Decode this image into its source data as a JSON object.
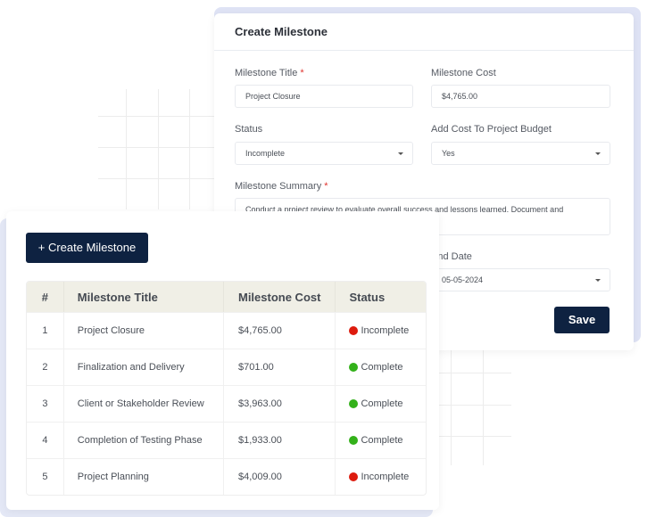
{
  "modal": {
    "title": "Create Milestone",
    "fields": {
      "milestone_title": {
        "label": "Milestone Title",
        "required": "*",
        "value": "Project Closure"
      },
      "milestone_cost": {
        "label": "Milestone Cost",
        "value": "$4,765.00"
      },
      "status": {
        "label": "Status",
        "value": "Incomplete"
      },
      "add_cost": {
        "label": "Add Cost To Project Budget",
        "value": "Yes"
      },
      "summary": {
        "label": "Milestone Summary",
        "required": "*",
        "value": "Conduct a project review to evaluate overall success and lessons learned. Document and"
      },
      "end_date": {
        "label": "End Date",
        "value": "05-05-2024"
      }
    },
    "save_label": "Save"
  },
  "table_card": {
    "create_button_label": "+ Create Milestone",
    "columns": [
      "#",
      "Milestone Title",
      "Milestone Cost",
      "Status"
    ],
    "rows": [
      {
        "num": "1",
        "title": "Project Closure",
        "cost": "$4,765.00",
        "status": "Incomplete",
        "status_color": "#dd1b0e"
      },
      {
        "num": "2",
        "title": "Finalization and Delivery",
        "cost": "$701.00",
        "status": "Complete",
        "status_color": "#33b11a"
      },
      {
        "num": "3",
        "title": "Client or Stakeholder Review",
        "cost": "$3,963.00",
        "status": "Complete",
        "status_color": "#33b11a"
      },
      {
        "num": "4",
        "title": "Completion of Testing Phase",
        "cost": "$1,933.00",
        "status": "Complete",
        "status_color": "#33b11a"
      },
      {
        "num": "5",
        "title": "Project Planning",
        "cost": "$4,009.00",
        "status": "Incomplete",
        "status_color": "#dd1b0e"
      }
    ]
  },
  "colors": {
    "primary_button": "#0e2241",
    "complete": "#33b11a",
    "incomplete": "#dd1b0e",
    "table_header_bg": "#f0efe6"
  }
}
